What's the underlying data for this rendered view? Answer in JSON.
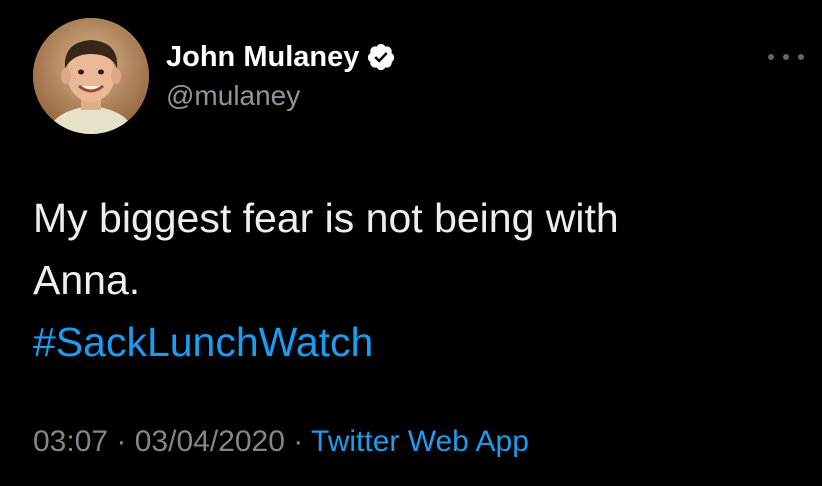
{
  "author": {
    "display_name": "John Mulaney",
    "handle": "@mulaney",
    "verified": true
  },
  "tweet": {
    "line1": "My biggest fear is not being with",
    "line2": "Anna.",
    "hashtag": "#SackLunchWatch"
  },
  "meta": {
    "time": "03:07",
    "separator": " · ",
    "date": "03/04/2020",
    "source": "Twitter Web App"
  },
  "icons": {
    "verified": "verified-badge-icon",
    "more": "more-options-icon"
  },
  "colors": {
    "background": "#000000",
    "link": "#1d9bf0",
    "muted": "#80868b",
    "text": "#eceff1"
  }
}
